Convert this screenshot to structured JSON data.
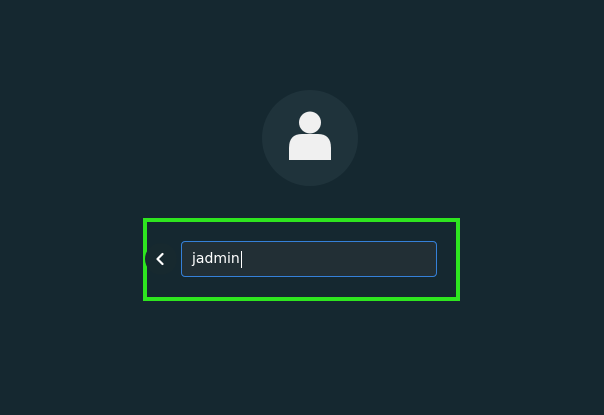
{
  "login": {
    "username_value": "jadmin"
  },
  "icons": {
    "avatar": "user-icon",
    "back": "chevron-left-icon"
  },
  "colors": {
    "background": "#152830",
    "avatar_bg": "#1f333b",
    "highlight": "#2ee51f",
    "field_border": "#3580d8",
    "field_bg": "#222f35"
  }
}
